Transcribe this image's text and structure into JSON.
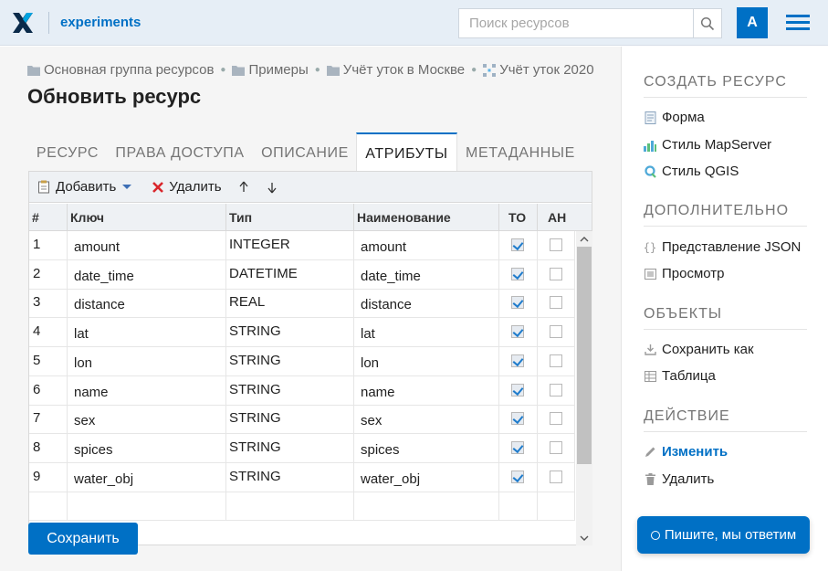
{
  "header": {
    "app_name": "experiments",
    "search_placeholder": "Поиск ресурсов",
    "avatar_letter": "A"
  },
  "breadcrumb": [
    {
      "label": "Основная группа ресурсов",
      "icon": "folder-icon"
    },
    {
      "label": "Примеры",
      "icon": "folder-icon"
    },
    {
      "label": "Учёт уток в Москве",
      "icon": "folder-icon"
    },
    {
      "label": "Учёт уток 2020",
      "icon": "vector-layer-icon"
    }
  ],
  "page_title": "Обновить ресурс",
  "tabs": [
    {
      "label": "РЕСУРС",
      "active": false
    },
    {
      "label": "ПРАВА ДОСТУПА",
      "active": false
    },
    {
      "label": "ОПИСАНИЕ",
      "active": false
    },
    {
      "label": "АТРИБУТЫ",
      "active": true
    },
    {
      "label": "МЕТАДАННЫЕ",
      "active": false
    }
  ],
  "toolbar": {
    "add_label": "Добавить",
    "delete_label": "Удалить"
  },
  "grid": {
    "columns": [
      "#",
      "Ключ",
      "Тип",
      "Наименование",
      "ТО",
      "АН"
    ],
    "rows": [
      {
        "num": "1",
        "key": "amount",
        "type": "INTEGER",
        "name": "amount",
        "to": true,
        "an": false
      },
      {
        "num": "2",
        "key": "date_time",
        "type": "DATETIME",
        "name": "date_time",
        "to": true,
        "an": false
      },
      {
        "num": "3",
        "key": "distance",
        "type": "REAL",
        "name": "distance",
        "to": true,
        "an": false
      },
      {
        "num": "4",
        "key": "lat",
        "type": "STRING",
        "name": "lat",
        "to": true,
        "an": false
      },
      {
        "num": "5",
        "key": "lon",
        "type": "STRING",
        "name": "lon",
        "to": true,
        "an": false
      },
      {
        "num": "6",
        "key": "name",
        "type": "STRING",
        "name": "name",
        "to": true,
        "an": false
      },
      {
        "num": "7",
        "key": "sex",
        "type": "STRING",
        "name": "sex",
        "to": true,
        "an": false
      },
      {
        "num": "8",
        "key": "spices",
        "type": "STRING",
        "name": "spices",
        "to": true,
        "an": false
      },
      {
        "num": "9",
        "key": "water_obj",
        "type": "STRING",
        "name": "water_obj",
        "to": true,
        "an": false
      }
    ]
  },
  "save_label": "Сохранить",
  "sidebar": {
    "create": {
      "title": "СОЗДАТЬ РЕСУРС",
      "items": [
        {
          "label": "Форма",
          "icon": "form-icon"
        },
        {
          "label": "Стиль MapServer",
          "icon": "mapserver-style-icon"
        },
        {
          "label": "Стиль QGIS",
          "icon": "qgis-style-icon"
        }
      ]
    },
    "extra": {
      "title": "ДОПОЛНИТЕЛЬНО",
      "items": [
        {
          "label": "Представление JSON",
          "icon": "json-icon"
        },
        {
          "label": "Просмотр",
          "icon": "preview-icon"
        }
      ]
    },
    "objects": {
      "title": "ОБЪЕКТЫ",
      "items": [
        {
          "label": "Сохранить как",
          "icon": "download-icon"
        },
        {
          "label": "Таблица",
          "icon": "table-icon"
        }
      ]
    },
    "action": {
      "title": "ДЕЙСТВИЕ",
      "items": [
        {
          "label": "Изменить",
          "icon": "edit-icon",
          "active": true
        },
        {
          "label": "Удалить",
          "icon": "trash-icon"
        }
      ]
    }
  },
  "chat_label": "Пишите, мы ответим",
  "colors": {
    "accent": "#0070c5",
    "header_bg": "#e6eef6",
    "main_bg": "#f5f5f5"
  }
}
